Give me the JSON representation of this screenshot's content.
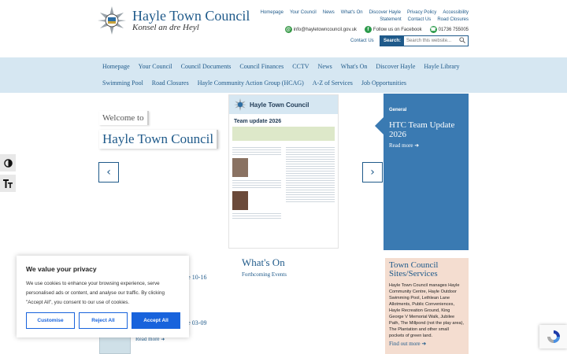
{
  "header": {
    "title": "Hayle Town Council",
    "subtitle": "Konsel an dre Heyl",
    "top_links": [
      "Homepage",
      "Your Council",
      "News",
      "What's On",
      "Discover Hayle",
      "Privacy Policy",
      "Accessibility"
    ],
    "top_links_row2": [
      "Statement",
      "Contact Us",
      "Road Closures"
    ],
    "email": "info@hayletowncouncil.gov.uk",
    "facebook": "Follow us on Facebook",
    "phone": "01736 755005",
    "contact_us": "Contact Us",
    "search_label": "Search:",
    "search_placeholder": "Search this website..."
  },
  "nav": {
    "row1": [
      "Homepage",
      "Your Council",
      "Council Documents",
      "Council Finances",
      "CCTV",
      "News",
      "What's On",
      "Discover Hayle",
      "Hayle Library"
    ],
    "row2": [
      "Swimming Pool",
      "Road Closures",
      "Hayle Community Action Group (HCAG)",
      "A-Z of Services",
      "Job Opportunities"
    ]
  },
  "welcome": {
    "small": "Welcome to",
    "big": "Hayle Town Council"
  },
  "newsletter": {
    "header": "Hayle Town Council",
    "title": "Team update 2026"
  },
  "feature": {
    "tag": "General",
    "title": "HTC Team Update 2026",
    "more": "Read more"
  },
  "whatson": {
    "title": "What's On",
    "sub": "Forthcoming Events"
  },
  "sites": {
    "title": "Town Council Sites/Services",
    "body": "Hayle Town Council manages Hayle Community Centre, Hayle Outdoor Swimming Pool, Lethlean Lane Allotments, Public Conveniences, Hayle Recreation Ground, King George V Memorial Walk, Jubilee Path, The Millpond (not the play area), The Plantation and other small pockets of green land.",
    "more": "Find out more"
  },
  "news": {
    "item1": "yle 10-16",
    "item2": "yle 03-09",
    "more": "Read more"
  },
  "cookie": {
    "title": "We value your privacy",
    "body": "We use cookies to enhance your browsing experience, serve personalised ads or content, and analyse our traffic. By clicking \"Accept All\", you consent to our use of cookies.",
    "customise": "Customise",
    "reject": "Reject All",
    "accept": "Accept All"
  },
  "colors": {
    "brand_blue": "#1f5a8a",
    "nav_bg": "#d6e7f2",
    "feature_blue": "#3a7ab2",
    "sites_bg": "#f4ddd0",
    "cookie_blue": "#1863dc"
  }
}
